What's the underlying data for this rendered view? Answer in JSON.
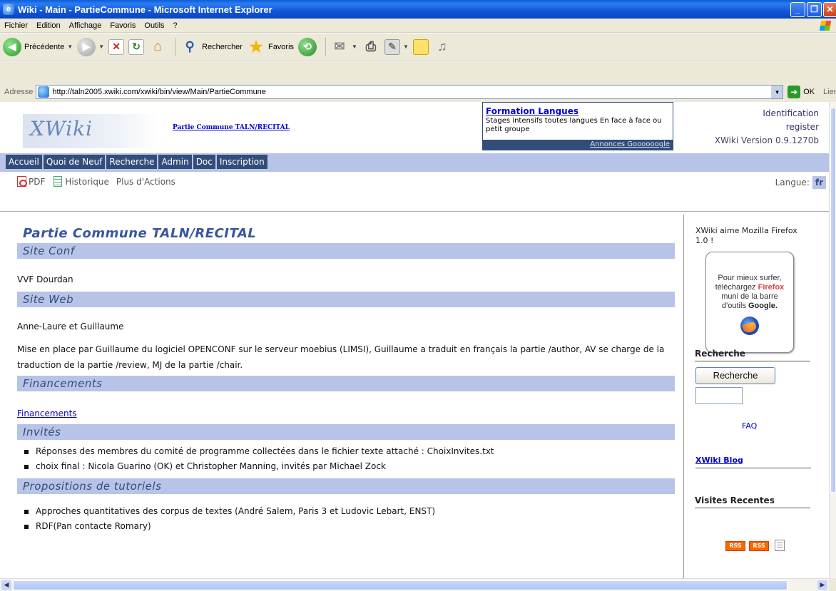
{
  "window": {
    "title": "Wiki - Main - PartieCommune - Microsoft Internet Explorer"
  },
  "menubar": {
    "items": [
      "Fichier",
      "Edition",
      "Affichage",
      "Favoris",
      "Outils",
      "?"
    ]
  },
  "toolbar": {
    "back_label": "Précédente",
    "search_label": "Rechercher",
    "favorites_label": "Favoris"
  },
  "address": {
    "label": "Adresse",
    "url": "http://taln2005.xwiki.com/xwiki/bin/view/Main/PartieCommune",
    "go_label": "OK",
    "links_label": "Liens"
  },
  "header": {
    "logo_text": "XWiki",
    "space_link": "Partie Commune TALN/RECITAL",
    "ad": {
      "title": "Formation Langues",
      "text": "Stages intensifs toutes langues En face à face ou petit groupe",
      "footer": "Annonces Goooooogle"
    },
    "user": {
      "login": "Identification",
      "register": "register",
      "version": "XWiki Version 0.9.1270b"
    }
  },
  "nav": {
    "items": [
      "Accueil",
      "Quoi de Neuf",
      "Recherche",
      "Admin",
      "Doc",
      "Inscription"
    ]
  },
  "actions": {
    "pdf": "PDF",
    "history": "Historique",
    "more": "Plus d'Actions",
    "lang_label": "Langue:",
    "lang_code": "fr"
  },
  "content": {
    "title": "Partie Commune TALN/RECITAL",
    "sections": {
      "site_conf": {
        "heading": "Site Conf",
        "text": "VVF Dourdan"
      },
      "site_web": {
        "heading": "Site Web",
        "text1": "Anne-Laure et Guillaume",
        "text2": "Mise en place par Guillaume du logiciel OPENCONF sur le serveur moebius (LIMSI), Guillaume a traduit en français la partie /author, AV se charge de la traduction de la partie /review, MJ de la partie /chair."
      },
      "financements": {
        "heading": "Financements",
        "link": "Financements"
      },
      "invites": {
        "heading": "Invités",
        "items": [
          "Réponses des membres du comité de programme collectées dans le fichier texte attaché : ChoixInvites.txt",
          "choix final : Nicola Guarino (OK) et Christopher Manning, invités par Michael Zock"
        ]
      },
      "tutoriels": {
        "heading": "Propositions de tutoriels",
        "items": [
          "Approches quantitatives des corpus de textes (André Salem, Paris 3 et Ludovic Lebart, ENST)",
          "RDF(Pan contacte Romary)"
        ]
      }
    }
  },
  "sidebar": {
    "firefox_text": "XWiki aime Mozilla Firefox 1.0 !",
    "firefox_box": {
      "line1": "Pour mieux surfer,",
      "line2_pre": "téléchargez ",
      "line2_brand": "Firefox",
      "line3": "muni de la barre",
      "line4_pre": "d'outils ",
      "line4_brand": "Google."
    },
    "search_heading": "Recherche",
    "search_button": "Recherche",
    "faq": "FAQ",
    "blog": "XWiki Blog",
    "recent": "Visites Recentes",
    "rss1": "RSS",
    "rss2": "RSS"
  }
}
